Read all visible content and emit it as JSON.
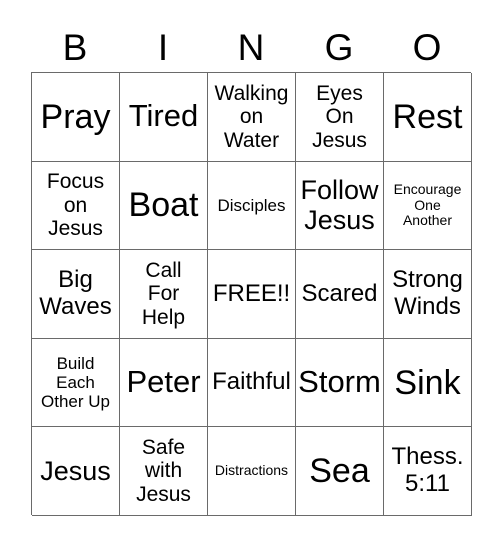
{
  "header": {
    "letters": [
      "B",
      "I",
      "N",
      "G",
      "O"
    ]
  },
  "grid": {
    "columns": 5,
    "rows": 5,
    "free_space_label": "FREE!!",
    "cells": [
      {
        "text": "Pray",
        "size": "fs-xxl"
      },
      {
        "text": "Tired",
        "size": "fs-xl"
      },
      {
        "text": "Walking\non\nWater",
        "size": "fs-s"
      },
      {
        "text": "Eyes\nOn\nJesus",
        "size": "fs-s"
      },
      {
        "text": "Rest",
        "size": "fs-xxl"
      },
      {
        "text": "Focus\non\nJesus",
        "size": "fs-s"
      },
      {
        "text": "Boat",
        "size": "fs-xxl"
      },
      {
        "text": "Disciples",
        "size": "fs-xs"
      },
      {
        "text": "Follow\nJesus",
        "size": "fs-l"
      },
      {
        "text": "Encourage\nOne\nAnother",
        "size": "fs-xxs"
      },
      {
        "text": "Big\nWaves",
        "size": "fs-m"
      },
      {
        "text": "Call\nFor\nHelp",
        "size": "fs-s"
      },
      {
        "text": "FREE!!",
        "size": "fs-m"
      },
      {
        "text": "Scared",
        "size": "fs-m"
      },
      {
        "text": "Strong\nWinds",
        "size": "fs-m"
      },
      {
        "text": "Build\nEach\nOther Up",
        "size": "fs-xs"
      },
      {
        "text": "Peter",
        "size": "fs-xl"
      },
      {
        "text": "Faithful",
        "size": "fs-m"
      },
      {
        "text": "Storm",
        "size": "fs-xl"
      },
      {
        "text": "Sink",
        "size": "fs-xxl"
      },
      {
        "text": "Jesus",
        "size": "fs-l"
      },
      {
        "text": "Safe\nwith\nJesus",
        "size": "fs-s"
      },
      {
        "text": "Distractions",
        "size": "fs-xxs"
      },
      {
        "text": "Sea",
        "size": "fs-xxl"
      },
      {
        "text": "Thess.\n5:11",
        "size": "fs-m"
      }
    ]
  },
  "colors": {
    "background": "#ffffff",
    "text": "#000000",
    "grid_line": "#6a6a6a"
  }
}
